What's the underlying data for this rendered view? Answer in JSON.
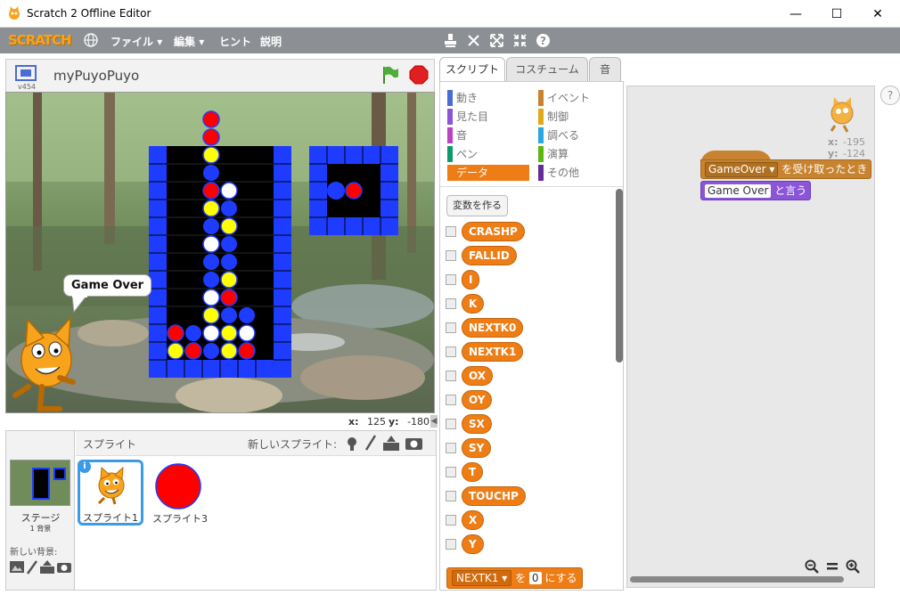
{
  "window": {
    "title": "Scratch 2 Offline Editor",
    "minimize": "—",
    "maximize": "☐",
    "close": "✕"
  },
  "menubar": {
    "logo": "SCRATCH",
    "file": "ファイル",
    "edit": "編集",
    "hint": "ヒント",
    "about": "説明"
  },
  "stage": {
    "project_name": "myPuyoPuyo",
    "version": "v454",
    "speech": "Game Over",
    "x_label": "x:",
    "x_value": "125",
    "y_label": "y:",
    "y_value": "-180"
  },
  "sprites": {
    "header": "スプライト",
    "new_sprite": "新しいスプライト:",
    "stage_label": "ステージ",
    "stage_backdrops": "1 背景",
    "new_backdrop": "新しい背景:",
    "items": [
      {
        "name": "スプライト1"
      },
      {
        "name": "スプライト3"
      }
    ]
  },
  "tabs": {
    "scripts": "スクリプト",
    "costumes": "コスチューム",
    "sounds": "音"
  },
  "categories": [
    {
      "label": "動き",
      "color": "#4a6cd4"
    },
    {
      "label": "見た目",
      "color": "#8a55d7"
    },
    {
      "label": "音",
      "color": "#bb42c3"
    },
    {
      "label": "ペン",
      "color": "#0e9a6c"
    },
    {
      "label": "データ",
      "color": "#ee7d16"
    },
    {
      "label": "イベント",
      "color": "#c88330"
    },
    {
      "label": "制御",
      "color": "#e1a91a"
    },
    {
      "label": "調べる",
      "color": "#2ca5e2"
    },
    {
      "label": "演算",
      "color": "#5cb712"
    },
    {
      "label": "その他",
      "color": "#632d99"
    }
  ],
  "palette": {
    "make_variable": "変数を作る",
    "variables": [
      "CRASHP",
      "FALLID",
      "I",
      "K",
      "NEXTK0",
      "NEXTK1",
      "OX",
      "OY",
      "SX",
      "SY",
      "T",
      "TOUCHP",
      "X",
      "Y"
    ],
    "set_block": {
      "var": "NEXTK1",
      "to": "を",
      "value": "0",
      "suffix": "にする"
    }
  },
  "scripts": {
    "sprite_x_label": "x:",
    "sprite_x": "-195",
    "sprite_y_label": "y:",
    "sprite_y": "-124",
    "hat": {
      "message": "GameOver",
      "suffix": "を受け取ったとき"
    },
    "say": {
      "text": "Game Over",
      "suffix": "と言う"
    }
  },
  "help": "?"
}
